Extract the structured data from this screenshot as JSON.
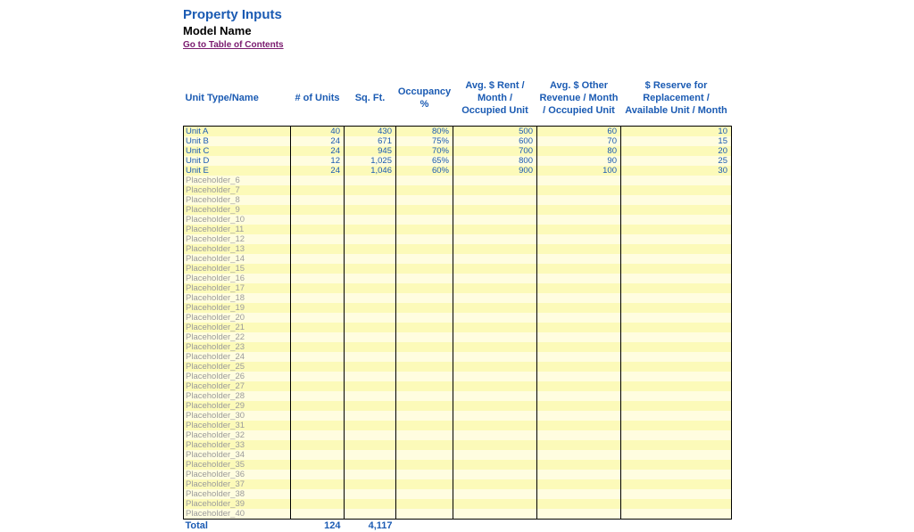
{
  "header": {
    "title": "Property Inputs",
    "subtitle": "Model Name",
    "toc_link": "Go to Table of Contents"
  },
  "columns": [
    "Unit Type/Name",
    "# of Units",
    "Sq. Ft.",
    "Occupancy %",
    "Avg. $ Rent / Month / Occupied Unit",
    "Avg. $ Other Revenue / Month / Occupied Unit",
    "$ Reserve for Replacement / Available Unit / Month"
  ],
  "rows": [
    {
      "name": "Unit A",
      "units": "40",
      "sqft": "430",
      "occ": "80%",
      "rent": "500",
      "other": "60",
      "res": "10"
    },
    {
      "name": "Unit B",
      "units": "24",
      "sqft": "671",
      "occ": "75%",
      "rent": "600",
      "other": "70",
      "res": "15"
    },
    {
      "name": "Unit C",
      "units": "24",
      "sqft": "945",
      "occ": "70%",
      "rent": "700",
      "other": "80",
      "res": "20"
    },
    {
      "name": "Unit D",
      "units": "12",
      "sqft": "1,025",
      "occ": "65%",
      "rent": "800",
      "other": "90",
      "res": "25"
    },
    {
      "name": "Unit E",
      "units": "24",
      "sqft": "1,046",
      "occ": "60%",
      "rent": "900",
      "other": "100",
      "res": "30"
    },
    {
      "name": "Placeholder_6",
      "ph": true
    },
    {
      "name": "Placeholder_7",
      "ph": true
    },
    {
      "name": "Placeholder_8",
      "ph": true
    },
    {
      "name": "Placeholder_9",
      "ph": true
    },
    {
      "name": "Placeholder_10",
      "ph": true
    },
    {
      "name": "Placeholder_11",
      "ph": true
    },
    {
      "name": "Placeholder_12",
      "ph": true
    },
    {
      "name": "Placeholder_13",
      "ph": true
    },
    {
      "name": "Placeholder_14",
      "ph": true
    },
    {
      "name": "Placeholder_15",
      "ph": true
    },
    {
      "name": "Placeholder_16",
      "ph": true
    },
    {
      "name": "Placeholder_17",
      "ph": true
    },
    {
      "name": "Placeholder_18",
      "ph": true
    },
    {
      "name": "Placeholder_19",
      "ph": true
    },
    {
      "name": "Placeholder_20",
      "ph": true
    },
    {
      "name": "Placeholder_21",
      "ph": true
    },
    {
      "name": "Placeholder_22",
      "ph": true
    },
    {
      "name": "Placeholder_23",
      "ph": true
    },
    {
      "name": "Placeholder_24",
      "ph": true
    },
    {
      "name": "Placeholder_25",
      "ph": true
    },
    {
      "name": "Placeholder_26",
      "ph": true
    },
    {
      "name": "Placeholder_27",
      "ph": true
    },
    {
      "name": "Placeholder_28",
      "ph": true
    },
    {
      "name": "Placeholder_29",
      "ph": true
    },
    {
      "name": "Placeholder_30",
      "ph": true
    },
    {
      "name": "Placeholder_31",
      "ph": true
    },
    {
      "name": "Placeholder_32",
      "ph": true
    },
    {
      "name": "Placeholder_33",
      "ph": true
    },
    {
      "name": "Placeholder_34",
      "ph": true
    },
    {
      "name": "Placeholder_35",
      "ph": true
    },
    {
      "name": "Placeholder_36",
      "ph": true
    },
    {
      "name": "Placeholder_37",
      "ph": true
    },
    {
      "name": "Placeholder_38",
      "ph": true
    },
    {
      "name": "Placeholder_39",
      "ph": true
    },
    {
      "name": "Placeholder_40",
      "ph": true
    }
  ],
  "totals": {
    "label": "Total",
    "units": "124",
    "sqft": "4,117"
  }
}
